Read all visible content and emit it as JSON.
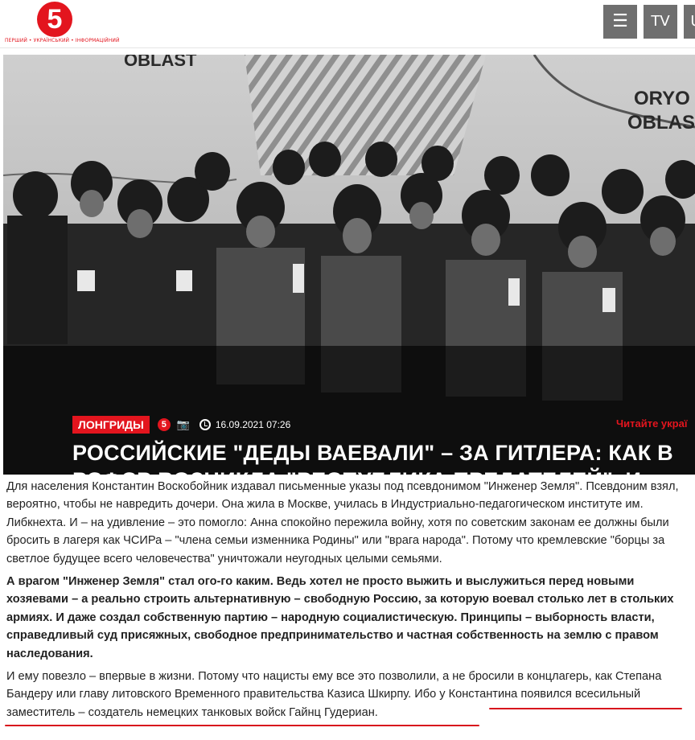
{
  "header": {
    "logo_text": "5",
    "logo_tagline": "ПЕРШИЙ • УКРАЇНСЬКИЙ • ІНФОРМАЦІЙНИЙ",
    "menu_icon": "hamburger-icon",
    "tv_label": "TV",
    "lang_label": "U"
  },
  "hero": {
    "map_labels": [
      "OBLAST",
      "ORYO",
      "OBLAS"
    ],
    "tag": "ЛОНГРИДЫ",
    "date": "16.09.2021 07:26",
    "read_ua": "Читайте украї",
    "headline": "РОССИЙСКИЕ \"ДЕДЫ ВАЕВАЛИ\" – ЗА ГИТЛЕРА: КАК В РСФСР ВОЗНИКЛА \"РЕСПУБЛИКА ПРЕДАТЕЛЕЙ\", И ПОЧЕМУ ОБ ЭТОМ СТЕСНЯЕТСЯ ГОВОРИТЬ ПУТИН"
  },
  "article": {
    "p1": "Для населения Константин Воскобойник издавал письменные указы под псевдонимом \"Инженер Земля\". Псевдоним взял, вероятно, чтобы не навредить дочери. Она жила в Москве, училась в Индустриально-педагогическом институте им. Либкнехта. И – на удивление – это помогло: Анна спокойно пережила войну, хотя по советским законам ее должны были бросить в лагеря как ЧСИРа – \"члена семьи изменника Родины\" или \"врага народа\". Потому что кремлевские \"борцы за светлое будущее всего человечества\" уничтожали неугодных целыми семьями.",
    "p2": "А врагом \"Инженер Земля\" стал ого-го каким. Ведь хотел не просто выжить и выслужиться перед новыми хозяевами – а реально строить альтернативную – свободную Россию, за которую воевал столько лет в стольких армиях. И даже создал собственную партию – народную социалистическую. Принципы – выборность власти, справедливый суд присяжных, свободное предпринимательство и частная собственность на землю с правом наследования.",
    "p3": "И ему повезло – впервые в жизни. Потому что нацисты ему все это позволили, а не бросили в концлагерь, как Степана Бандеру или главу литовского Временного правительства Казиса Шкирпу. Ибо у Константина появился всесильный заместитель – создатель немецких танковых войск Гайнц Гудериан."
  },
  "colors": {
    "brand_red": "#e3151e",
    "header_button": "#6f6f6f"
  }
}
